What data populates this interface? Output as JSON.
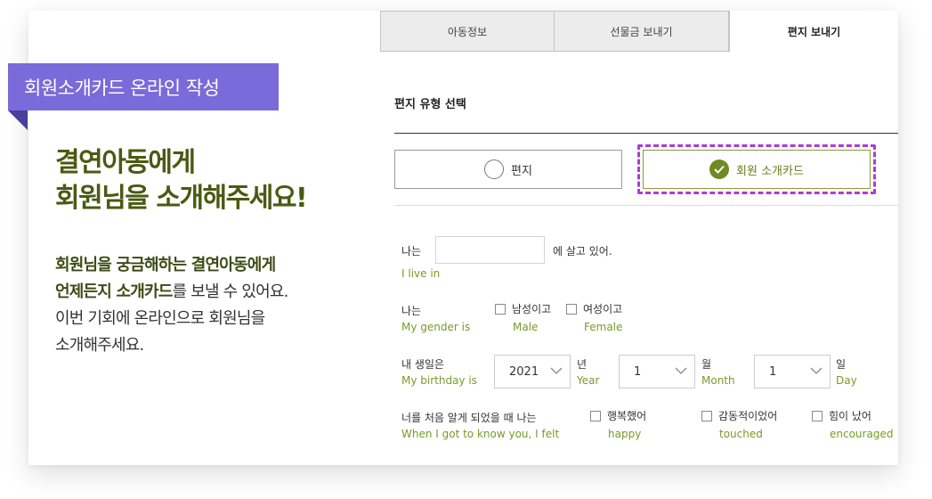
{
  "promo": {
    "ribbon": "회원소개카드 온라인 작성",
    "headline": [
      "결연아동에게",
      "회원님을 소개해주세요!"
    ],
    "description": {
      "line1": "회원님을 궁금해하는 결연아동에게",
      "line2_strong": "언제든지 소개카드",
      "line2_rest": "를 보낼 수 있어요.",
      "line3": "이번 기회에 온라인으로 회원님을",
      "line4": "소개해주세요."
    }
  },
  "tabs": [
    {
      "label": "아동정보"
    },
    {
      "label": "선물금 보내기"
    },
    {
      "label": "편지 보내기",
      "active": true
    }
  ],
  "letter_type": {
    "title": "편지 유형 선택",
    "options": [
      {
        "label": "편지",
        "selected": false
      },
      {
        "label": "회원 소개카드",
        "selected": true
      }
    ]
  },
  "form": {
    "live": {
      "label": "나는",
      "sub": "I live in",
      "suffix": "에 살고 있어.",
      "value": ""
    },
    "gender": {
      "label": "나는",
      "sub": "My gender is",
      "options": [
        {
          "label": "남성이고",
          "sub": "Male",
          "checked": false
        },
        {
          "label": "여성이고",
          "sub": "Female",
          "checked": false
        }
      ]
    },
    "birthday": {
      "label": "내 생일은",
      "sub": "My birthday is",
      "year": {
        "value": "2021",
        "unit": "년",
        "unit_sub": "Year"
      },
      "month": {
        "value": "1",
        "unit": "월",
        "unit_sub": "Month"
      },
      "day": {
        "value": "1",
        "unit": "일",
        "unit_sub": "Day"
      }
    },
    "felt": {
      "label": "너를 처음 알게 되었을 때 나는",
      "sub": "When I got to know you, I felt",
      "options": [
        {
          "label": "행복했어",
          "sub": "happy",
          "checked": false
        },
        {
          "label": "감동적이었어",
          "sub": "touched",
          "checked": false
        },
        {
          "label": "힘이 났어",
          "sub": "encouraged",
          "checked": false
        }
      ]
    }
  },
  "colors": {
    "ribbon": "#7b6ad9",
    "headline": "#4a5a12",
    "accent_green": "#7a9a2a",
    "highlight_dash": "#b03ad8"
  }
}
